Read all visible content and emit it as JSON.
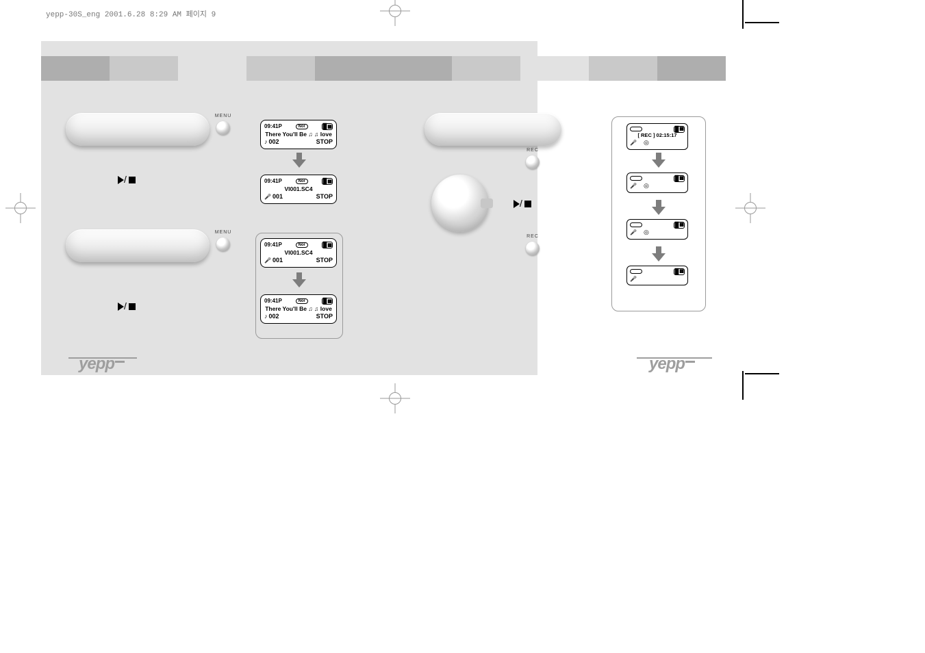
{
  "header": "yepp-30S_eng  2001.6.28  8:29 AM  페이지 9",
  "labels": {
    "menu": "MENU",
    "rec": "REC",
    "playstop_sep": "/"
  },
  "screens_left": [
    {
      "time": "09:41P",
      "mode": "Nor",
      "title": "There You'll Be ♫ ♫ love",
      "track": "002",
      "icon": "note",
      "status": "STOP"
    },
    {
      "time": "09:41P",
      "mode": "Nor",
      "title": "VI001.SC4",
      "track": "001",
      "icon": "mic",
      "status": "STOP"
    },
    {
      "time": "09:41P",
      "mode": "Nor",
      "title": "VI001.SC4",
      "track": "001",
      "icon": "mic",
      "status": "STOP"
    },
    {
      "time": "09:41P",
      "mode": "Nor",
      "title": "There You'll Be ♫ ♫ love",
      "track": "002",
      "icon": "note",
      "status": "STOP"
    }
  ],
  "screens_right": [
    {
      "title": "[ REC ] 02:15:17"
    },
    {
      "title": ""
    },
    {
      "title": ""
    },
    {
      "title": ""
    }
  ],
  "logo": "yepp"
}
